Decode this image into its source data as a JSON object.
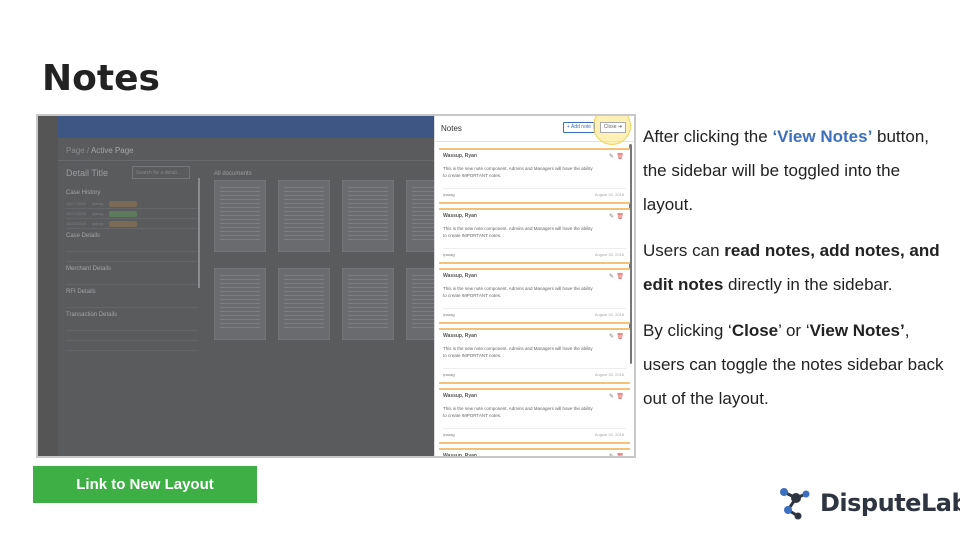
{
  "slide": {
    "title": "Notes",
    "link_button_label": "Link to New Layout",
    "logo_text": "DisputeLab"
  },
  "screenshot": {
    "breadcrumb": {
      "root": "Page",
      "sep": "/",
      "current": "Active Page"
    },
    "detail_title": "Detail Title",
    "search_placeholder": "Search for a detail...",
    "documents_label": "All documents",
    "sections": [
      "Case History",
      "Case Details",
      "Merchant Details",
      "RFI Details",
      "Transaction Details"
    ],
    "sidebar": {
      "title": "Notes",
      "add_button": "+ Add note",
      "close_button": "Close",
      "notes": [
        {
          "author": "Wassup, Ryan",
          "body": "This is the new note component. Admins and Managers will have the ability to create IMPORTANT notes.",
          "user": "rparag",
          "date": "August 30, 2018"
        },
        {
          "author": "Wassup, Ryan",
          "body": "This is the new note component. Admins and Managers will have the ability to create IMPORTANT notes.",
          "user": "rparag",
          "date": "August 30, 2018"
        },
        {
          "author": "Wassup, Ryan",
          "body": "This is the new note component. Admins and Managers will have the ability to create IMPORTANT notes.",
          "user": "rparag",
          "date": "August 30, 2018"
        },
        {
          "author": "Wassup, Ryan",
          "body": "This is the new note component. Admins and Managers will have the ability to create IMPORTANT notes.",
          "user": "rparag",
          "date": "August 30, 2018"
        },
        {
          "author": "Wassup, Ryan",
          "body": "This is the new note component. Admins and Managers will have the ability to create IMPORTANT notes.",
          "user": "rparag",
          "date": "August 30, 2018"
        },
        {
          "author": "Wassup, Ryan",
          "body": "",
          "user": "",
          "date": ""
        }
      ]
    }
  },
  "description": {
    "p1_before": "After clicking the ",
    "p1_highlight": "‘View Notes’",
    "p1_after": " button, the sidebar will be toggled into the layout.",
    "p2_before": "Users can ",
    "p2_bold": "read notes, add notes, and edit notes",
    "p2_after": " directly in the sidebar.",
    "p3_before": "By clicking ‘",
    "p3_bold1": "Close",
    "p3_mid": "’ or ‘",
    "p3_bold2": "View Notes’",
    "p3_after": ", users can toggle the notes sidebar back out of the layout."
  },
  "colors": {
    "accent_blue": "#3e6fbf",
    "button_green": "#3daf45",
    "note_border": "#f5c07a",
    "highlight": "#ffe678"
  },
  "icons": [
    "edit-icon",
    "delete-icon",
    "plus-icon",
    "arrow-right-icon",
    "logo-molecule-icon"
  ]
}
